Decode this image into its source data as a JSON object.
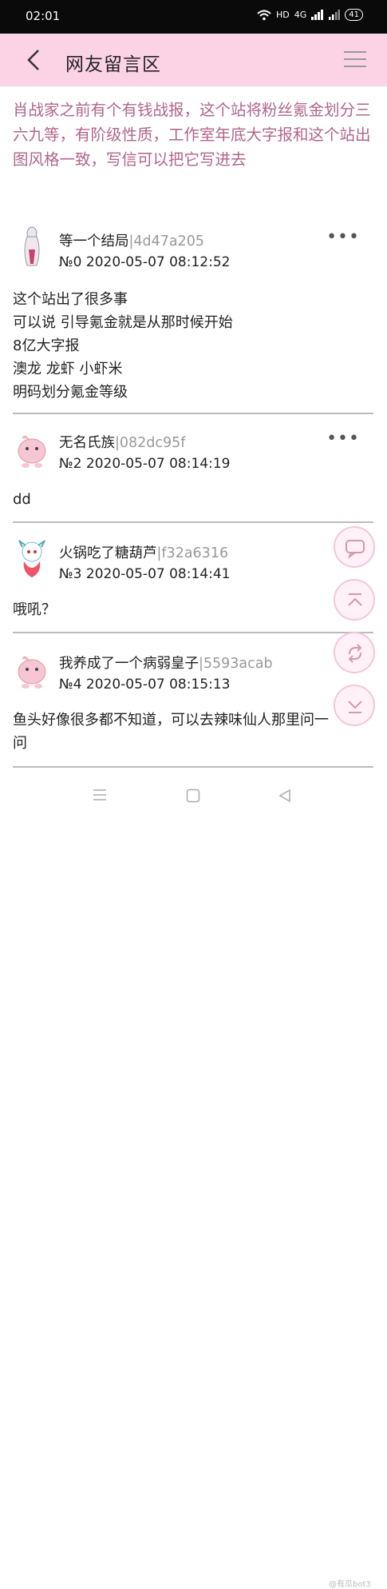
{
  "status_bar": {
    "time": "02:01",
    "network": "HD",
    "signal_label": "4G",
    "battery": "41"
  },
  "header": {
    "title": "网友留言区"
  },
  "topic": {
    "text": "肖战家之前有个有钱战报，这个站将粉丝氪金划分三六九等，有阶级性质，工作室年底大字报和这个站出图风格一致，写信可以把它写进去"
  },
  "posts": [
    {
      "author": "等一个结局",
      "hash": "|4d47a205",
      "meta": "№0  2020-05-07 08:12:52",
      "content": "这个站出了很多事\n可以说 引导氪金就是从那时候开始\n8亿大字报\n澳龙 龙虾 小虾米\n明码划分氪金等级"
    },
    {
      "author": "无名氏族",
      "hash": "|082dc95f",
      "meta": "№2  2020-05-07 08:14:19",
      "content": "dd"
    },
    {
      "author": "火锅吃了糖葫芦",
      "hash": "|f32a6316",
      "meta": "№3  2020-05-07 08:14:41",
      "content": "哦吼？"
    },
    {
      "author": "我养成了一个病弱皇子",
      "hash": "|5593acab",
      "meta": "№4  2020-05-07 08:15:13",
      "content": "鱼头好像很多都不知道，可以去辣味仙人那里问一问"
    }
  ],
  "more_label": "•••",
  "watermark": "@有瓜bot3",
  "colors": {
    "header_bg": "#fcd3e4",
    "topic_text": "#b0658a",
    "float_border": "#f3c7d8"
  }
}
